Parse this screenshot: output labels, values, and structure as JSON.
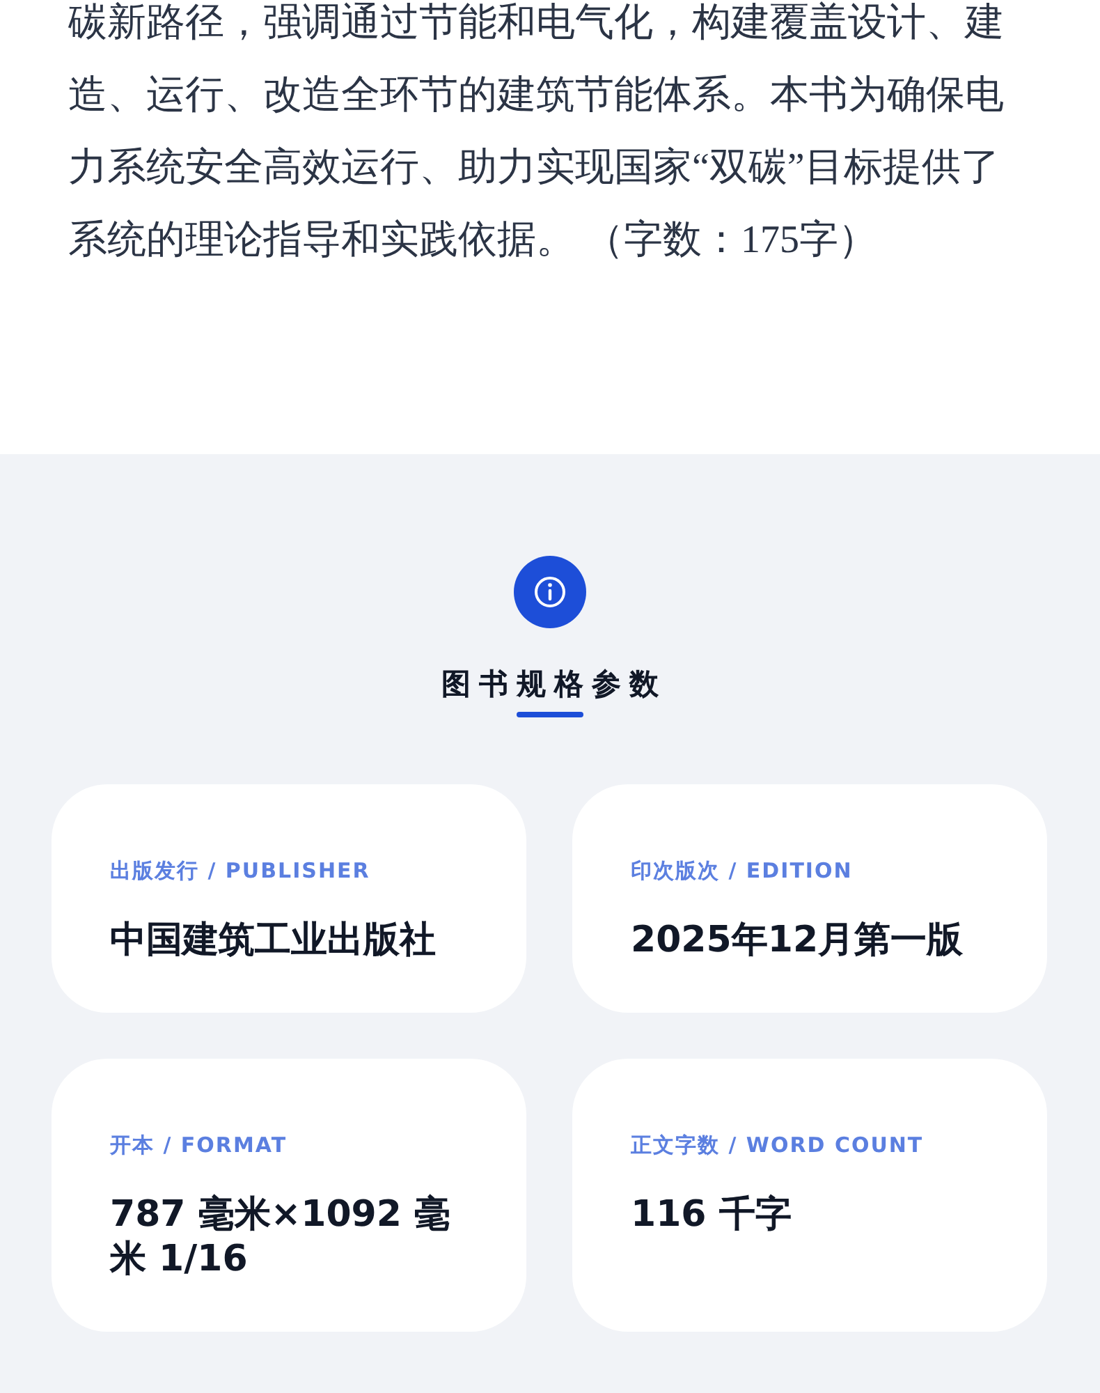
{
  "description": "碳新路径，强调通过节能和电气化，构建覆盖设计、建造、运行、改造全环节的建筑节能体系。本书为确保电力系统安全高效运行、助力实现国家“双碳”目标提供了系统的理论指导和实践依据。 （字数：175字）",
  "specs": {
    "title": "图书规格参数",
    "items": [
      {
        "label": "出版发行 / PUBLISHER",
        "value": "中国建筑工业出版社"
      },
      {
        "label": "印次版次 / EDITION",
        "value": "2025年12月第一版"
      },
      {
        "label": "开本 / FORMAT",
        "value": "787 毫米×1092 毫米 1/16"
      },
      {
        "label": "正文字数 / WORD COUNT",
        "value": "116 千字"
      }
    ]
  }
}
